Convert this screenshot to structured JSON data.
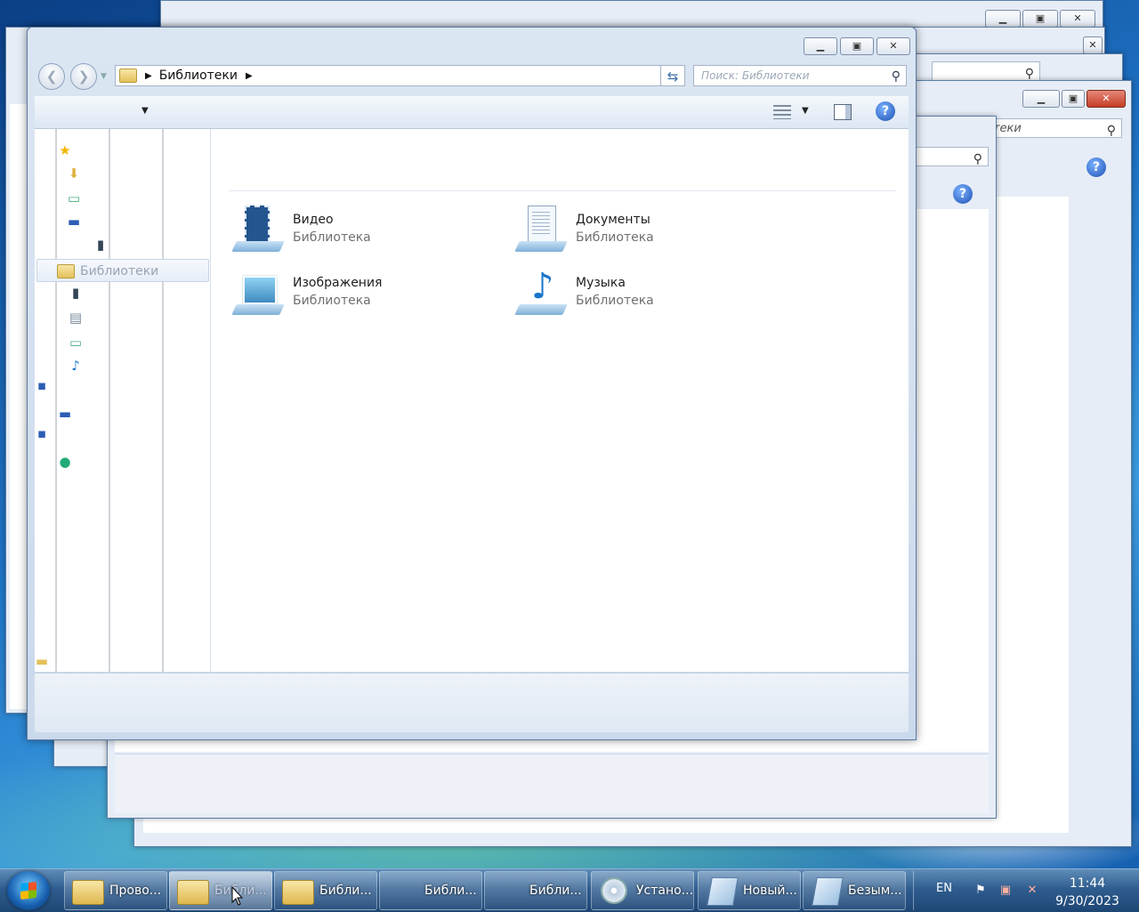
{
  "main_window": {
    "breadcrumb": "Библиотеки",
    "search_placeholder": "Поиск: Библиотеки",
    "nav_selected": "Библиотеки",
    "libraries": [
      {
        "name": "Видео",
        "type": "Библиотека",
        "icon": "video-library-icon"
      },
      {
        "name": "Документы",
        "type": "Библиотека",
        "icon": "documents-library-icon"
      },
      {
        "name": "Изображения",
        "type": "Библиотека",
        "icon": "pictures-library-icon"
      },
      {
        "name": "Музыка",
        "type": "Библиотека",
        "icon": "music-library-icon"
      }
    ]
  },
  "background_window": {
    "search_text": "отеки"
  },
  "taskbar": {
    "items": [
      {
        "label": "Прово..."
      },
      {
        "label": "Библи..."
      },
      {
        "label": "Библи..."
      },
      {
        "label": "Библи..."
      },
      {
        "label": "Библи..."
      },
      {
        "label": "Устано..."
      },
      {
        "label": "Новый..."
      },
      {
        "label": "Безым..."
      }
    ],
    "lang": "EN",
    "time": "11:44",
    "date": "9/30/2023"
  },
  "colors": {
    "accent": "#3a6ea5",
    "help": "#1d4fb3",
    "close_red": "#c53d25"
  }
}
